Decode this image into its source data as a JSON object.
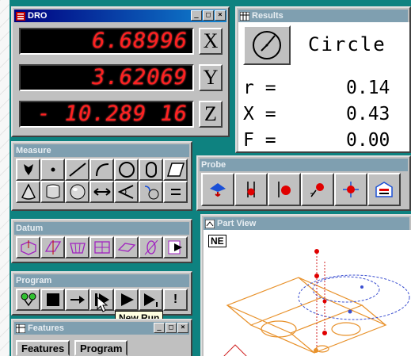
{
  "dro": {
    "title": "DRO",
    "x_value": "6.68996",
    "y_value": "3.62069",
    "z_value": "- 10.289 16",
    "axis_x": "X",
    "axis_y": "Y",
    "axis_z": "Z"
  },
  "results": {
    "title": "Results",
    "feature_type": "Circle",
    "rows": [
      {
        "label": "r  =",
        "value": "0.14"
      },
      {
        "label": "X  =",
        "value": "0.43"
      },
      {
        "label": "F  =",
        "value": "0.00"
      }
    ]
  },
  "measure": {
    "title": "Measure"
  },
  "probe": {
    "title": "Probe"
  },
  "datum": {
    "title": "Datum"
  },
  "program": {
    "title": "Program",
    "exclaim": "!"
  },
  "partview": {
    "title": "Part View",
    "view_label": "NE"
  },
  "tooltip": {
    "text": "New Run"
  },
  "features": {
    "title": "Features",
    "tabs": [
      "Features",
      "Program"
    ]
  },
  "window_buttons": {
    "minimize": "_",
    "maximize": "□",
    "close": "×"
  },
  "colors": {
    "desktop": "#0e8280",
    "dro_digits": "#ff2020",
    "title_active": "#000080",
    "part_wireframe": "#e8912a"
  }
}
